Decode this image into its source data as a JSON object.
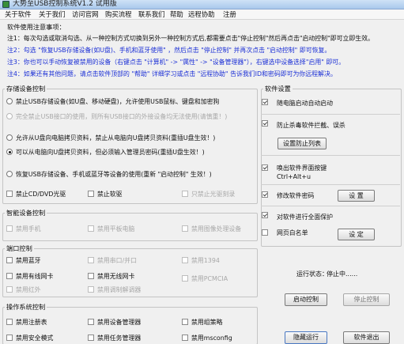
{
  "window": {
    "title": "大势至USB控制系统V1.2 试用版"
  },
  "menu": [
    {
      "label": "关于软件"
    },
    {
      "label": "关于我们"
    },
    {
      "label": "访问官网"
    },
    {
      "label": "购买流程"
    },
    {
      "label": "联系我们"
    },
    {
      "label": "帮助"
    },
    {
      "label": "远程协助"
    },
    {
      "label": "注册"
    }
  ],
  "notes": {
    "title": "软件使用注意事项：",
    "items": [
      {
        "a": "注1：每次勾选或取消勾选、从一种控制方式切换到另外一种控制方式后,都需要点击\"停止控制\"然后再点击\"启动控制\"即可立即生效。",
        "b": ""
      },
      {
        "a": "注2：勾选 \"恢复USB存储设备(如U盘)、手机和蓝牙使用\" ，然后点击 \"停止控制\" 并再次点击 \"启动控制\" 即可恢复。",
        "b": ""
      },
      {
        "a": "注3：你也可以手动恢复被禁用的设备（右键点击 \"计算机\" -> \"属性\" -> \"设备管理器\"），右键选中设备选择\"启用\" 即可。",
        "b": ""
      },
      {
        "a": "注4：如果还有其他问题，请点击软件顶部的 \"帮助\" 详细学习或点击 \"远程协助\" 告诉我们ID和密码即可为你远程解决。",
        "b": ""
      }
    ]
  },
  "storage": {
    "label": "存储设备控制",
    "options": [
      {
        "label": "禁止USB存储设备(如U盘、移动硬盘)，允许使用USB鼠标、键盘和加密狗"
      },
      {
        "label": "完全禁止USB接口的使用，则所有USB接口的外接设备均无法使用(请慎重！)"
      },
      {
        "label": "允许从U盘向电脑拷贝资料，禁止从电脑向U盘拷贝资料(重插U盘生效！)"
      },
      {
        "label": "可以从电脑向U盘拷贝资料，但必须输入管理员密码(重插U盘生效！)"
      },
      {
        "label": "恢复USB存储设备、手机或蓝牙等设备的使用(重新 \"启动控制\" 生效！)"
      }
    ],
    "extras": [
      {
        "label": "禁止CD/DVD光驱"
      },
      {
        "label": "禁止软驱"
      },
      {
        "label": "只禁止光驱刻录"
      }
    ]
  },
  "smart": {
    "label": "智能设备控制",
    "items": [
      {
        "label": "禁用手机"
      },
      {
        "label": "禁用平板电脑"
      },
      {
        "label": "禁用图像处理设备"
      }
    ]
  },
  "ports": {
    "label": "端口控制",
    "items": [
      {
        "label": "禁用蓝牙"
      },
      {
        "label": "禁用串口/并口"
      },
      {
        "label": "禁用1394"
      },
      {
        "label": "禁用有线网卡"
      },
      {
        "label": "禁用无线网卡"
      },
      {
        "label": "禁用PCMCIA"
      },
      {
        "label": "禁用红外"
      },
      {
        "label": "禁用调制解调器"
      }
    ]
  },
  "os": {
    "label": "操作系统控制",
    "items": [
      {
        "label": "禁用注册表"
      },
      {
        "label": "禁用设备管理器"
      },
      {
        "label": "禁用组策略"
      },
      {
        "label": "禁用安全模式"
      },
      {
        "label": "禁用任务管理器"
      },
      {
        "label": "禁用msconfig"
      }
    ]
  },
  "settings": {
    "label": "软件设置",
    "autostart": "随电脑启动自动启动",
    "antivirus": "防止杀毒软件拦截、误杀",
    "whitelist_btn": "设置防止列表",
    "hotkey": "唤出软件界面按键\nCtrl+Alt+u",
    "password": "修改软件密码",
    "password_btn": "设 置",
    "protect": "对软件进行全面保护",
    "webwhite": "网页白名单",
    "webwhite_btn": "设 定"
  },
  "status": {
    "label": "运行状态：",
    "value": "停止中......"
  },
  "actions": {
    "start": "启动控制",
    "stop": "停止控制",
    "hide": "隐藏运行",
    "exit": "软件退出"
  },
  "colors": {
    "accent": "#1b2fd6",
    "disabled": "#a8a8a8",
    "window_bg": "#f0f0f0"
  }
}
